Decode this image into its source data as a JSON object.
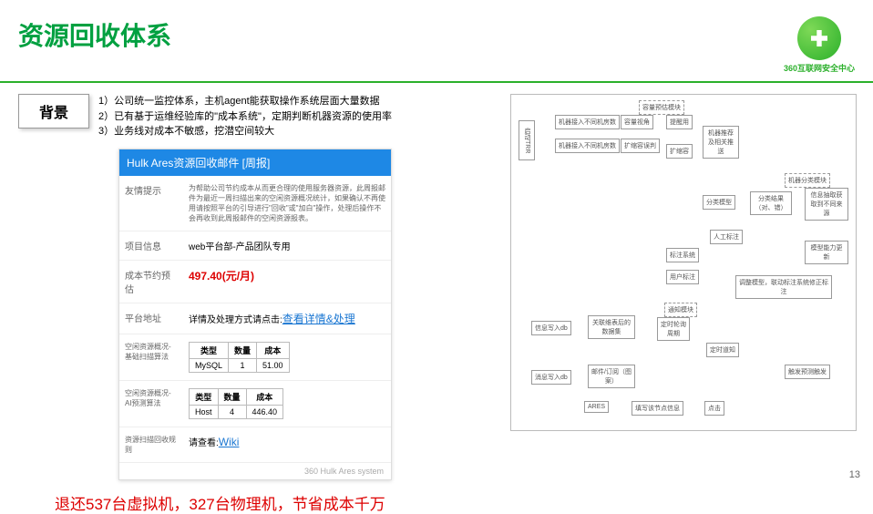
{
  "header": {
    "title": "资源回收体系",
    "logo_text": "360互联网安全中心"
  },
  "background": {
    "label": "背景",
    "line1": "1）公司统一监控体系，主机agent能获取操作系统层面大量数据",
    "line2": "2）已有基于运维经验库的\"成本系统\"，定期判断机器资源的使用率",
    "line3": "3）业务线对成本不敏感，挖潜空间较大"
  },
  "email": {
    "title": "Hulk Ares资源回收邮件 [周报]",
    "rows": {
      "tip_label": "友情提示",
      "tip_value": "为帮助公司节约成本从而更合理的使用服务器资源，此周报邮件为最近一周扫描出来的空闲资源概况统计，如果确认不再使用请按照平台的引导进行\"回收\"或\"加白\"操作，处理后操作不会再收到此周报邮件的空闲资源报表。",
      "proj_label": "项目信息",
      "proj_value": "web平台部-产品团队专用",
      "cost_label": "成本节约预估",
      "cost_value": "497.40(元/月)",
      "platform_label": "平台地址",
      "platform_prefix": "详情及处理方式请点击:",
      "platform_link": "查看详情&处理",
      "idle1_label": "空闲资源概况-基础扫描算法",
      "idle2_label": "空闲资源概况-AI预测算法",
      "rule_label": "资源扫描回收规则",
      "rule_prefix": "请查看:",
      "rule_link": "Wiki"
    },
    "table1": {
      "h1": "类型",
      "h2": "数量",
      "h3": "成本",
      "r1c1": "MySQL",
      "r1c2": "1",
      "r1c3": "51.00"
    },
    "table2": {
      "h1": "类型",
      "h2": "数量",
      "h3": "成本",
      "r1c1": "Host",
      "r1c2": "4",
      "r1c3": "446.40"
    },
    "footer": "360 Hulk Ares system"
  },
  "summary": "退还537台虚拟机，327台物理机，节省成本千万",
  "flow": {
    "sec1_title": "容量预估模块",
    "b1": "启动TRR",
    "b2": "机器接入不同机房数",
    "b3": "容量视角",
    "b4": "提醒用",
    "b5": "机器接入不同机房数",
    "b6": "扩缩容误判",
    "b7": "机器推荐及相关推送",
    "b8": "扩缩容",
    "sec2_title": "机器分类模块",
    "b9": "分类模型",
    "b10": "分类结果（对、错）",
    "b11": "信息抽取获取到不同来源",
    "b12": "人工标注",
    "b13": "标注系统",
    "b14": "模型能力更新",
    "b15": "用户标注",
    "b16": "调整模型，联动标注系统修正标注",
    "sec3_title": "通知模块",
    "b17": "信息写入db",
    "b18": "关联维表后的数据集",
    "b19": "定时轮询周期",
    "b20": "定时道知",
    "b21": "消息写入db",
    "b22": "邮件/订阅（图案）",
    "b23": "ARES",
    "b24": "填写该节点信息",
    "b25": "点击",
    "b26": "触发预测触发"
  },
  "page_number": "13"
}
